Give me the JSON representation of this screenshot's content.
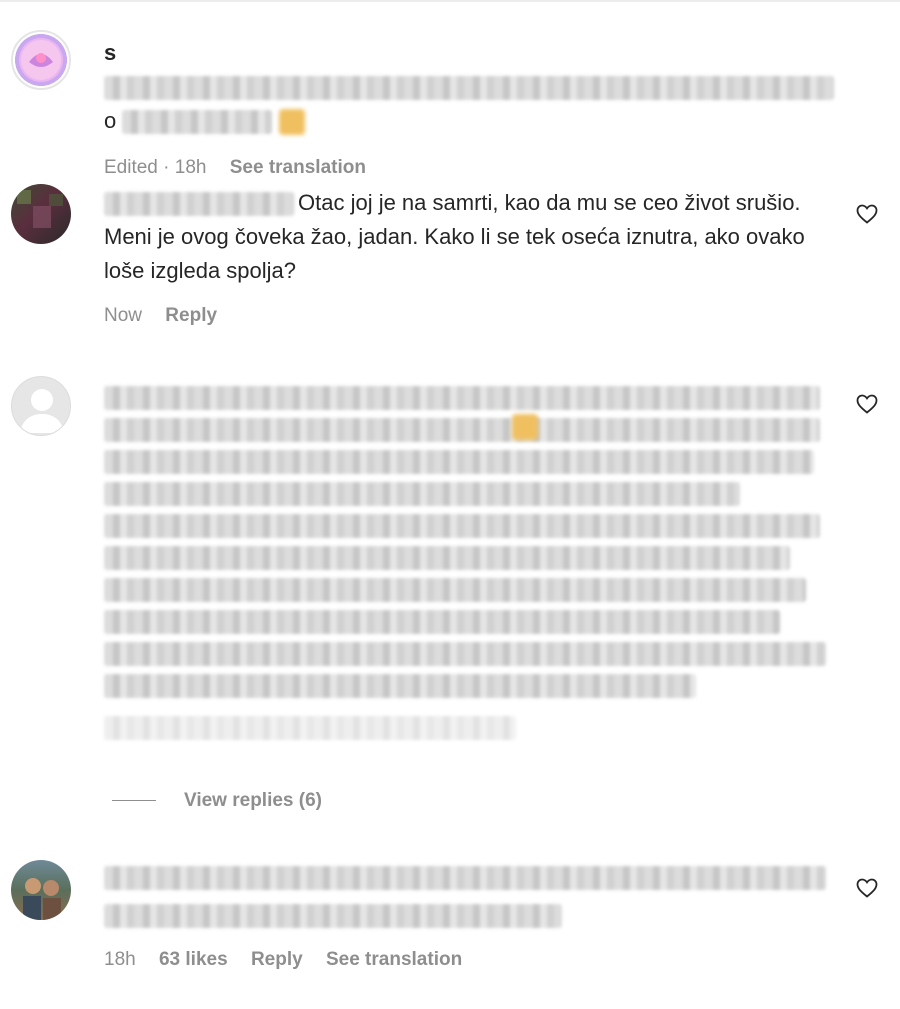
{
  "comments": [
    {
      "username": "s",
      "text_start": "o",
      "meta": {
        "edited": "Edited · 18h",
        "see_translation": "See translation"
      }
    },
    {
      "text": "Otac joj je na samrti, kao da mu se ceo život srušio. Meni je ovog čoveka žao, jadan. Kako li se tek oseća iznutra, ako ovako loše izgleda spolja?",
      "meta": {
        "time": "Now",
        "reply": "Reply"
      }
    },
    {
      "view_replies": "View replies (6)"
    },
    {
      "meta": {
        "time": "18h",
        "likes": "63 likes",
        "reply": "Reply",
        "see_translation": "See translation"
      }
    }
  ],
  "icons": {
    "like": "heart-outline-icon",
    "default_avatar": "default-user-avatar-icon"
  },
  "colors": {
    "text": "#262626",
    "meta": "#8e8e8e",
    "divider": "#ececec"
  }
}
